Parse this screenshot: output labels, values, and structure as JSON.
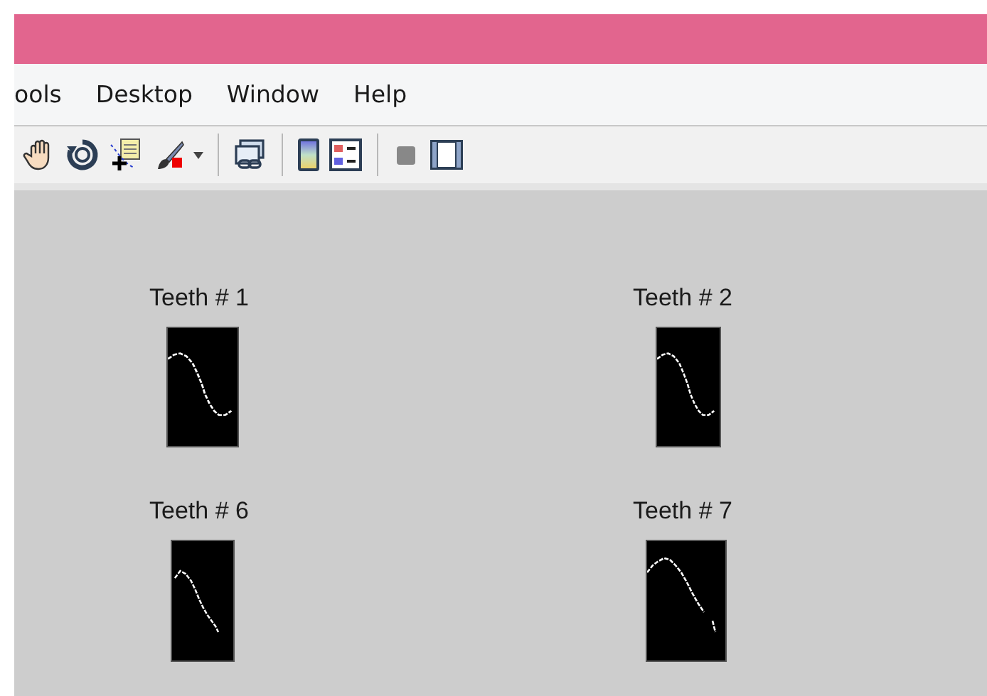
{
  "menu": [
    "ools",
    "Desktop",
    "Window",
    "Help"
  ],
  "toolbar": [
    {
      "kind": "hand"
    },
    {
      "kind": "rotate"
    },
    {
      "kind": "cursor"
    },
    {
      "kind": "brush"
    },
    {
      "kind": "dropdown"
    },
    {
      "kind": "separator"
    },
    {
      "kind": "link"
    },
    {
      "kind": "separator"
    },
    {
      "kind": "colorbar"
    },
    {
      "kind": "legend"
    },
    {
      "kind": "separator"
    },
    {
      "kind": "hide"
    },
    {
      "kind": "dock"
    }
  ],
  "panels": [
    {
      "title": "Teeth # 1",
      "kind": "s"
    },
    {
      "title": "Teeth # 2",
      "kind": "s"
    },
    {
      "title": "Teeth # 6",
      "kind": "fall"
    },
    {
      "title": "Teeth # 7",
      "kind": "hump"
    }
  ]
}
